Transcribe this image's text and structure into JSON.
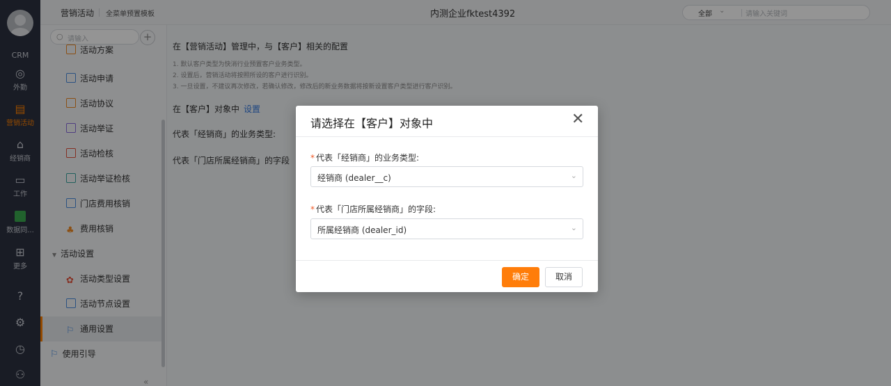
{
  "rail": {
    "crm_label": "CRM",
    "items": [
      {
        "label": "外勤",
        "icon": "location-icon",
        "glyph": "◎"
      },
      {
        "label": "营销活动",
        "icon": "marketing-icon",
        "glyph": "▤"
      },
      {
        "label": "经销商",
        "icon": "dealer-icon",
        "glyph": "⌂"
      },
      {
        "label": "工作",
        "icon": "work-icon",
        "glyph": "▭"
      },
      {
        "label": "数据同...",
        "icon": "data-sync-icon"
      },
      {
        "label": "更多",
        "icon": "more-grid-icon",
        "glyph": "⊞"
      }
    ],
    "bottom_icons": [
      {
        "icon": "help-icon",
        "glyph": "?"
      },
      {
        "icon": "settings-icon",
        "glyph": "⚙"
      },
      {
        "icon": "history-icon",
        "glyph": "◷"
      },
      {
        "icon": "contacts-icon",
        "glyph": "⚇"
      }
    ],
    "active_color": "#ff8000"
  },
  "topbar": {
    "app_title": "营销活动",
    "template_label": "全菜单预置模板",
    "company": "内测企业fktest4392",
    "search_scope": "全部",
    "search_placeholder": "请输入关键词"
  },
  "sidebar": {
    "search_placeholder": "请输入",
    "add_glyph": "+",
    "items": [
      {
        "label": "活动方案",
        "icon": "plan-icon"
      },
      {
        "label": "活动申请",
        "icon": "application-icon"
      },
      {
        "label": "活动协议",
        "icon": "agreement-icon"
      },
      {
        "label": "活动举证",
        "icon": "evidence-icon"
      },
      {
        "label": "活动检核",
        "icon": "inspection-icon"
      },
      {
        "label": "活动举证检核",
        "icon": "evidence-inspection-icon"
      },
      {
        "label": "门店费用核销",
        "icon": "store-expense-icon"
      },
      {
        "label": "费用核销",
        "icon": "expense-icon"
      }
    ],
    "group": {
      "label": "活动设置"
    },
    "group_items": [
      {
        "label": "活动类型设置",
        "icon": "type-settings-icon"
      },
      {
        "label": "活动节点设置",
        "icon": "node-settings-icon"
      },
      {
        "label": "通用设置",
        "icon": "flag-icon",
        "active": true
      }
    ],
    "guide": {
      "label": "使用引导",
      "icon": "guide-flag-icon"
    },
    "collapse_glyph": "«"
  },
  "main": {
    "heading": "在【营销活动】管理中，与【客户】相关的配置",
    "notes": [
      "1. 默认客户类型为快消行业预置客户业务类型。",
      "2. 设置后，营销活动将按照所设的客户进行识别。",
      "3. 一旦设置，不建议再次修改，若确认修改，修改后的新业务数据将按新设置客户类型进行客户识别。"
    ],
    "object_line": "在【客户】对象中",
    "object_link": "设置",
    "field_labels": [
      "代表「经销商」的业务类型:",
      "代表「门店所属经销商」的字段"
    ]
  },
  "modal": {
    "title": "请选择在【客户】对象中",
    "close_glyph": "✕",
    "fields": [
      {
        "required": "*",
        "label": "代表「经销商」的业务类型:",
        "value": "经销商 (dealer__c)"
      },
      {
        "required": "*",
        "label": "代表「门店所属经销商」的字段:",
        "value": "所属经销商 (dealer_id)"
      }
    ],
    "ok_label": "确定",
    "cancel_label": "取消",
    "primary_color": "#ff7d0a"
  }
}
